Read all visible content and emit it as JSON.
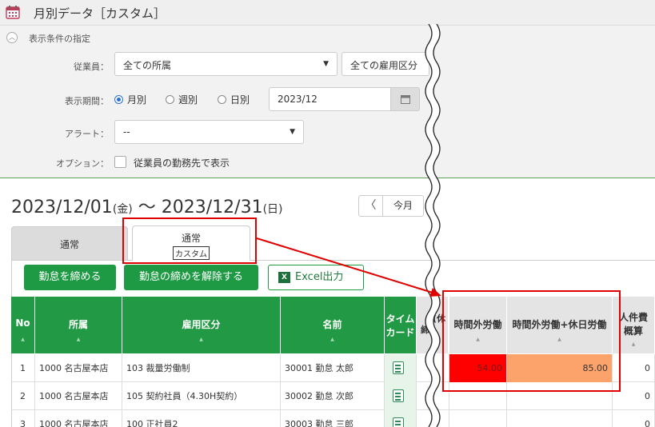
{
  "app": {
    "title": "月別データ［カスタム］"
  },
  "conditions": {
    "header": "表示条件の指定",
    "employee_label": "従業員：",
    "affiliation_value": "全ての所属",
    "employment_value": "全ての雇用区分",
    "period_label": "表示期間：",
    "period_options": [
      "月別",
      "週別",
      "日別"
    ],
    "period_selected": "月別",
    "date_value": "2023/12",
    "alert_label": "アラート：",
    "alert_value": "--",
    "option_label": "オプション：",
    "option_checkbox": "従業員の勤務先で表示"
  },
  "period_heading": {
    "start": "2023/12/01",
    "start_day": "(金)",
    "sep": "〜",
    "end": "2023/12/31",
    "end_day": "(日)",
    "today_button": "今月",
    "prev_glyph": "〈"
  },
  "tabs": [
    {
      "label": "通常",
      "sub": ""
    },
    {
      "label": "通常",
      "sub": "カスタム"
    }
  ],
  "buttons": {
    "close": "勤怠を締める",
    "unclose": "勤怠の締めを解除する",
    "excel": "Excel出力",
    "excel_icon": "X"
  },
  "table": {
    "headers_left": [
      "No",
      "所属",
      "雇用区分",
      "名前"
    ],
    "header_card": [
      "タイム",
      "カード"
    ],
    "header_partial": [
      "(休",
      "締"
    ],
    "headers_right": [
      "時間外労働",
      "時間外労働+休日労働"
    ],
    "header_cost": [
      "人件費",
      "概算"
    ],
    "rows": [
      {
        "no": "1",
        "affiliation": "1000 名古屋本店",
        "employment": "103 裁量労働制",
        "name": "30001 勤怠 太郎",
        "overtime": "54.00",
        "overtime_holiday": "85.00",
        "cost": "0"
      },
      {
        "no": "2",
        "affiliation": "1000 名古屋本店",
        "employment": "105 契約社員（4.30H契約）",
        "name": "30002 勤怠 次郎",
        "overtime": "",
        "overtime_holiday": "",
        "cost": "0"
      },
      {
        "no": "3",
        "affiliation": "1000 名古屋本店",
        "employment": "100 正社員2",
        "name": "30003 勤怠 三郎",
        "overtime": "",
        "overtime_holiday": "",
        "cost": "0"
      }
    ]
  },
  "colors": {
    "accent_green": "#229a45",
    "overtime_alert": "#ff0000",
    "overtime_holiday_warn": "#fca36b",
    "annotation_red": "#e00000"
  }
}
